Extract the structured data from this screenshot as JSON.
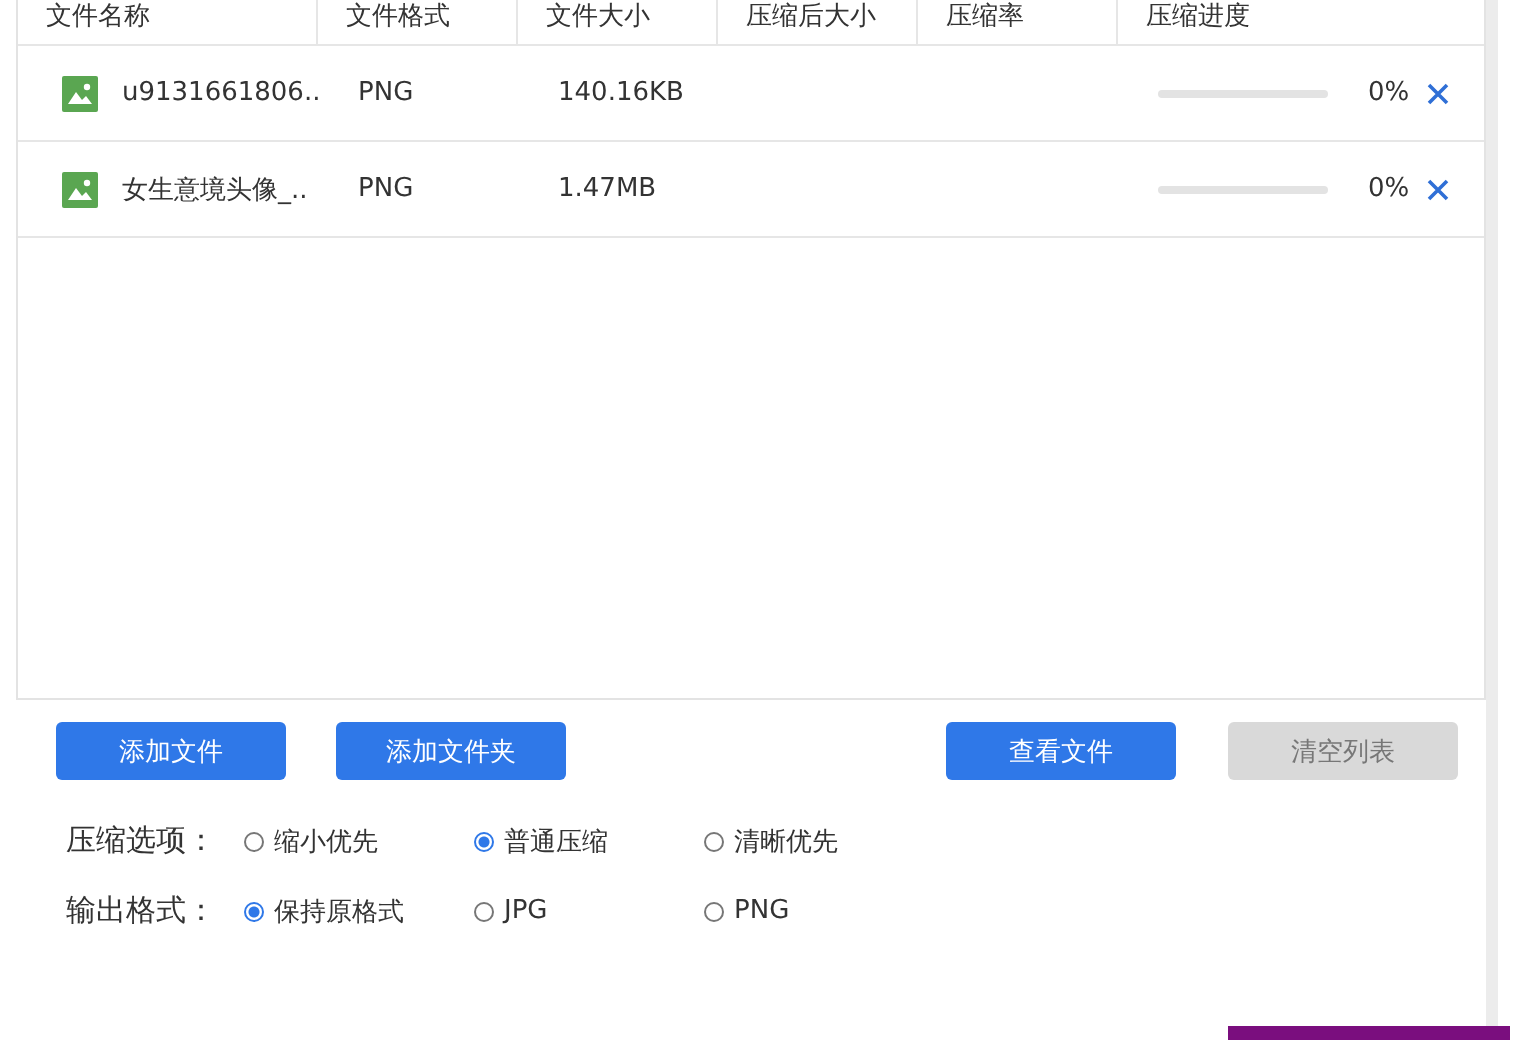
{
  "table": {
    "columns": [
      "文件名称",
      "文件格式",
      "文件大小",
      "压缩后大小",
      "压缩率",
      "压缩进度"
    ],
    "rows": [
      {
        "name": "u9131661806..",
        "format": "PNG",
        "size": "140.16KB",
        "level": 0,
        "percent": "0%"
      },
      {
        "name": "女生意境头像_..",
        "format": "PNG",
        "size": "1.47MB",
        "level": 0,
        "percent": "0%"
      }
    ]
  },
  "buttons": [
    {
      "label": "添加文件",
      "disabled": false
    },
    {
      "label": "添加文件夹",
      "disabled": false
    },
    {
      "label": "查看文件",
      "disabled": false
    },
    {
      "label": "清空列表",
      "disabled": true
    }
  ],
  "option_groups": [
    {
      "label": "压缩选项：",
      "options": [
        {
          "label": "缩小优先",
          "selected": false
        },
        {
          "label": "普通压缩",
          "selected": true
        },
        {
          "label": "清晰优先",
          "selected": false
        }
      ]
    },
    {
      "label": "输出格式：",
      "options": [
        {
          "label": "保持原格式",
          "selected": true
        },
        {
          "label": "JPG",
          "selected": false
        },
        {
          "label": "PNG",
          "selected": false
        }
      ]
    }
  ]
}
